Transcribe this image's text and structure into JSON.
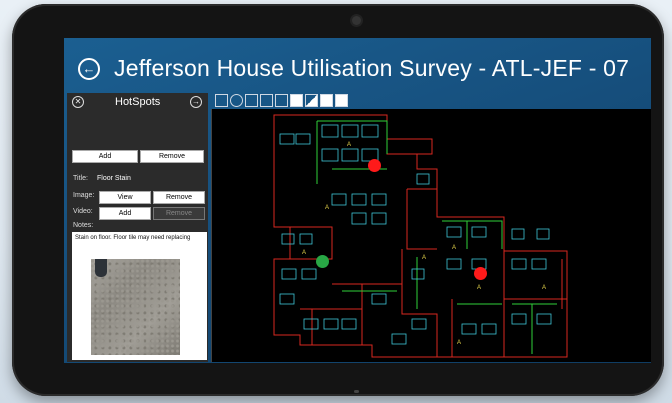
{
  "window": {
    "title": "Jefferson House Utilisation Survey - ATL-JEF - 07"
  },
  "panel": {
    "title": "HotSpots",
    "add_label": "Add",
    "remove_label": "Remove",
    "title_label": "Title:",
    "title_value": "Floor Stain",
    "image_label": "Image:",
    "image_view": "View",
    "image_remove": "Remove",
    "video_label": "Video:",
    "video_add": "Add",
    "video_remove": "Remove",
    "notes_label": "Notes:",
    "notes_text": "Stain on floor. Floor tile may need replacing"
  },
  "icons": {
    "back": "back-arrow-icon",
    "close": "close-icon",
    "forward": "forward-arrow-icon"
  },
  "hotspots": [
    {
      "color": "#ff1a1a"
    },
    {
      "color": "#28a745"
    },
    {
      "color": "#ff1a1a"
    }
  ],
  "colors": {
    "screen_blue": "#1b5f91",
    "panel_dark": "#2b2b2b",
    "plan_red": "#d9281f",
    "plan_cyan": "#3fc6d8",
    "plan_green": "#2fd03a",
    "plan_yellow": "#e3d24a"
  }
}
